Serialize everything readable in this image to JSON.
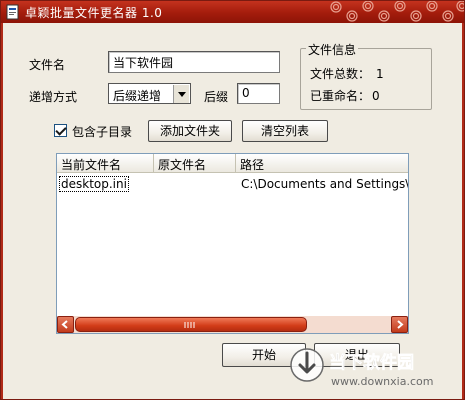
{
  "window": {
    "title": "卓颖批量文件更名器 1.0",
    "accent_color": "#a31c0c"
  },
  "form": {
    "filename_label": "文件名",
    "filename_value": "当下软件园",
    "increment_label": "递增方式",
    "increment_value": "后缀递增",
    "suffix_label": "后缀",
    "suffix_value": "0"
  },
  "file_info": {
    "title": "文件信息",
    "total_label": "文件总数：",
    "total_value": "1",
    "renamed_label": "已重命名：",
    "renamed_value": "0"
  },
  "options": {
    "include_subdirs_label": "包含子目录",
    "include_subdirs_checked": true,
    "add_folder_button": "添加文件夹",
    "clear_list_button": "清空列表"
  },
  "file_list": {
    "columns": [
      "当前文件名",
      "原文件名",
      "路径"
    ],
    "rows": [
      {
        "current": "desktop.ini",
        "original": "",
        "path": "C:\\Documents and Settings\\Ac"
      }
    ]
  },
  "actions": {
    "start_button": "开始",
    "exit_button": "退出"
  },
  "watermark": {
    "brand": "当下软件园",
    "url": "www.downxia.com"
  }
}
